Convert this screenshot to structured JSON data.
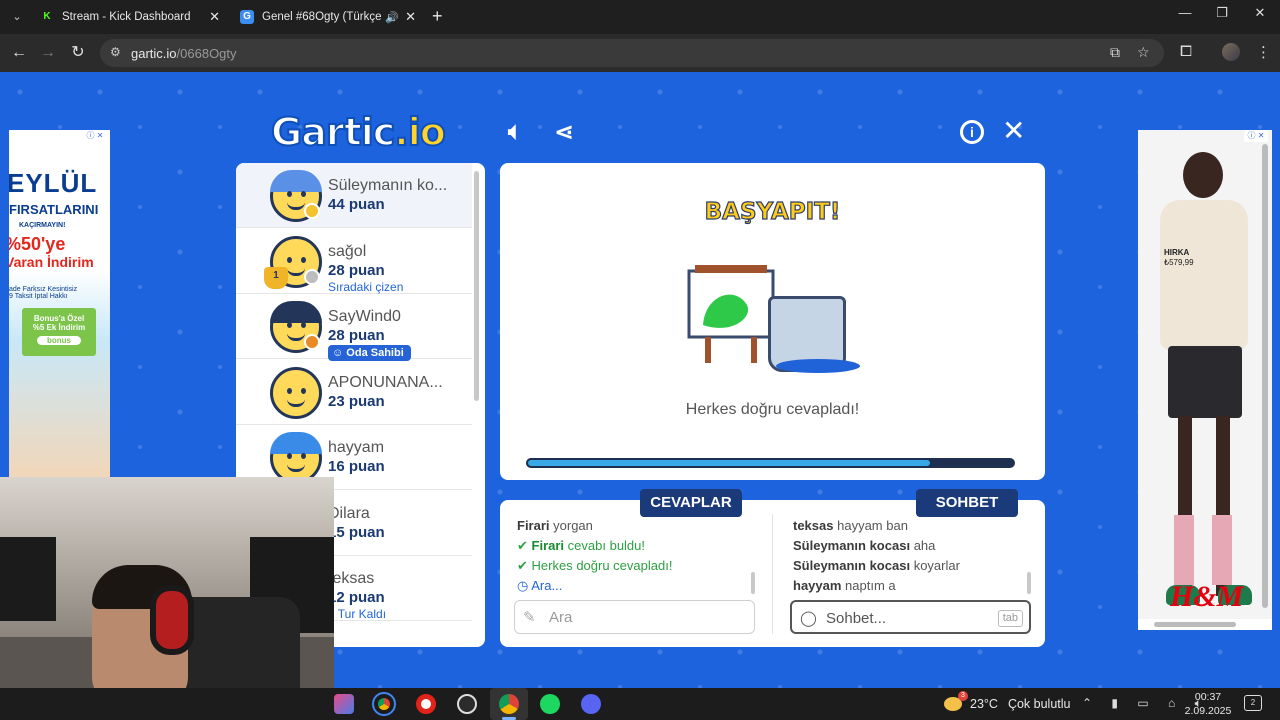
{
  "browser": {
    "tabs": [
      {
        "title": "Stream - Kick Dashboard",
        "favicon": "K",
        "favicon_color": "#53fc18"
      },
      {
        "title": "Genel #68Ogty (Türkçe) - G",
        "favicon": "G",
        "favicon_color": "#3b8df0"
      }
    ],
    "url_host": "gartic.io",
    "url_path": "/0668Ogty"
  },
  "game": {
    "logo_main": "Gartic",
    "logo_io": ".io",
    "board": {
      "title": "BAŞYAPIT!",
      "message": "Herkes doğru cevapladı!",
      "progress": 0.83
    },
    "players": [
      {
        "name": "Süleymanın ko...",
        "score": "44 puan",
        "sub": "",
        "dot": "#f3c230",
        "hair": "#5a90e6"
      },
      {
        "name": "sağol",
        "score": "28 puan",
        "sub": "Sıradaki çizen",
        "dot": "#bdbdbd",
        "hair": "",
        "trophy": "1"
      },
      {
        "name": "SayWind0",
        "score": "28 puan",
        "owner": "Oda Sahibi",
        "dot": "#e98a25",
        "hair": "#23365a"
      },
      {
        "name": "APONUNANA...",
        "score": "23 puan",
        "sub": "",
        "dot": "",
        "hair": ""
      },
      {
        "name": "hayyam",
        "score": "16 puan",
        "sub": "",
        "dot": "",
        "hair": "#3a8be8"
      },
      {
        "name": "Dilara",
        "score": "15 puan",
        "sub": "",
        "dot": "",
        "hair": ""
      },
      {
        "name": "teksas",
        "score": "12 puan",
        "sub": "1 Tur Kaldı",
        "dot": "",
        "hair": ""
      }
    ],
    "answers": {
      "label": "CEVAPLAR",
      "messages": [
        {
          "user": "Firari",
          "text": "yorgan"
        },
        {
          "user": "Firari",
          "text": "cevabı buldu!"
        },
        {
          "text": "Herkes doğru cevapladı!"
        },
        {
          "text": "Ara..."
        }
      ],
      "placeholder": "Ara"
    },
    "chat": {
      "label": "SOHBET",
      "messages": [
        {
          "user": "teksas",
          "text": "hayyam ban"
        },
        {
          "user": "Süleymanın kocası",
          "text": "aha"
        },
        {
          "user": "Süleymanın kocası",
          "text": "koyarlar"
        },
        {
          "user": "hayyam",
          "text": "naptım a"
        }
      ],
      "placeholder": "Sohbet...",
      "tab_key": "tab"
    }
  },
  "ads": {
    "left": {
      "line1": "EYLÜL",
      "line2": "FIRSATLARINI",
      "line3": "KAÇIRMAYIN!",
      "line4": "%50'ye",
      "line5": "Varan İndirim",
      "line6": "ade Farksız  Kesintisiz",
      "line7": "9 Taksit   İptal Hakkı",
      "bonus1": "Bonus'a Özel",
      "bonus2": "%5 Ek İndirim",
      "bonus3": "bonus"
    },
    "right": {
      "product": "HIRKA",
      "price": "₺579,99",
      "brand": "H&M"
    }
  },
  "taskbar": {
    "weather_temp": "23°C",
    "weather_text": "Çok bulutlu",
    "weather_badge": "3",
    "time": "00:37",
    "date": "2.09.2025",
    "notif_count": "2"
  }
}
